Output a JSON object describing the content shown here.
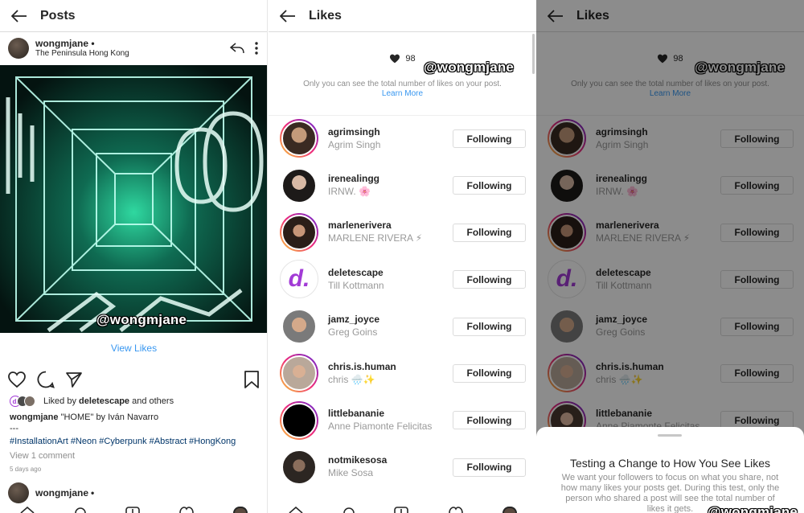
{
  "watermark": "@wongmjane",
  "posts": {
    "title": "Posts",
    "username": "wongmjane",
    "dot": "•",
    "location": "The Peninsula Hong Kong",
    "view_likes": "View Likes",
    "liked_by_prefix": "Liked by",
    "liked_by_user": "deletescape",
    "liked_by_suffix": "and others",
    "caption_user": "wongmjane",
    "caption_text": "\"HOME\" by Iván Navarro",
    "caption_sep": "---",
    "hashtags": "#InstallationArt #Neon #Cyberpunk #Abstract #HongKong",
    "view_comments": "View 1 comment",
    "time_ago": "5 days ago",
    "next_username": "wongmjane"
  },
  "likes": {
    "title": "Likes",
    "count": "98",
    "note": "Only you can see the total number of likes on your post.",
    "learn_more": "Learn More",
    "button_label": "Following",
    "users": [
      {
        "username": "agrimsingh",
        "fullname": "Agrim Singh"
      },
      {
        "username": "irenealingg",
        "fullname": "IRNW. 🌸"
      },
      {
        "username": "marlenerivera",
        "fullname": "MARLENE RIVERA ⚡"
      },
      {
        "username": "deletescape",
        "fullname": "Till Kottmann"
      },
      {
        "username": "jamz_joyce",
        "fullname": "Greg Goins"
      },
      {
        "username": "chris.is.human",
        "fullname": "chris 🌧️✨"
      },
      {
        "username": "littlebananie",
        "fullname": "Anne Piamonte Felicitas"
      },
      {
        "username": "notmikesosa",
        "fullname": "Mike Sosa"
      }
    ]
  },
  "sheet": {
    "title": "Testing a Change to How You See Likes",
    "body": "We want your followers to focus on what you share, not how many likes your posts get. During this test, only the person who shared a post will see the total number of likes it gets."
  },
  "colors": {
    "link": "#3897f0",
    "hashtag": "#003569",
    "story_ring": "#ee2a7b",
    "deletescape_purple": "#a23bd6"
  }
}
